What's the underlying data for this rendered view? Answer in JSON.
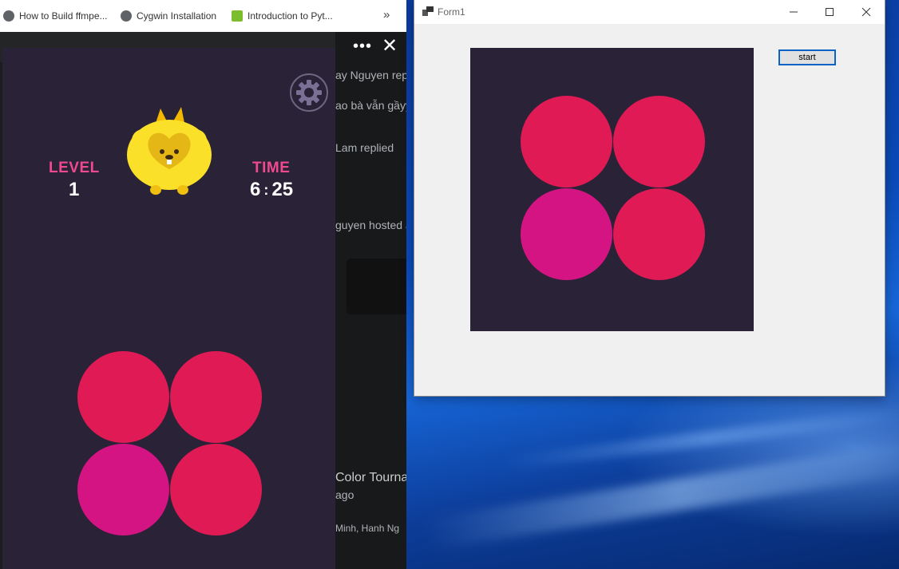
{
  "browser": {
    "bookmarks": [
      {
        "label": "How to Build ffmpe..."
      },
      {
        "label": "Cygwin Installation"
      },
      {
        "label": "Introduction to Pyt..."
      }
    ],
    "more_label": "»",
    "menu_dots": "•••",
    "close_label": "✕"
  },
  "behind_texts": [
    {
      "text": "ay Nguyen repli"
    },
    {
      "text": "ao bà vẫn gầyy"
    },
    {
      "text": "Lam replied"
    },
    {
      "text": "guyen hosted a"
    },
    {
      "text": "Color Tourna"
    },
    {
      "text": "ago"
    },
    {
      "text": "Minh, Hanh Ng"
    }
  ],
  "game": {
    "level_label": "LEVEL",
    "level_value": "1",
    "time_label": "TIME",
    "time_minutes": "6",
    "time_separator": ":",
    "time_seconds": "25"
  },
  "form1": {
    "title": "Form1",
    "start_label": "start"
  },
  "colors": {
    "panel_bg": "#2a2237",
    "circle_red": "#e01a55",
    "circle_magenta": "#d51483",
    "label_pink": "#ef4a8f"
  },
  "icons": [
    "gear-icon",
    "mascot-icon",
    "minimize-icon",
    "maximize-icon",
    "close-icon"
  ]
}
